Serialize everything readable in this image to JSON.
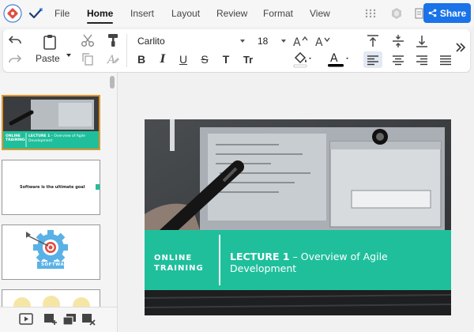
{
  "menu": {
    "items": [
      "File",
      "Home",
      "Insert",
      "Layout",
      "Review",
      "Format",
      "View"
    ],
    "active": "Home",
    "share_label": "Share"
  },
  "toolbar": {
    "paste_label": "Paste",
    "font_name": "Carlito",
    "font_size": "18",
    "font_color": "#000000",
    "highlight_color": "#ffffff"
  },
  "slides": [
    {
      "left_text": "ONLINE TRAINING",
      "title_bold": "LECTURE 1",
      "title_rest": " – Overview of Agile Development"
    },
    {
      "text": "Software is the ultimate goal"
    },
    {
      "label": "SOFTWA"
    },
    {}
  ],
  "current_slide": {
    "left_text_line1": "ONLINE",
    "left_text_line2": "TRAINING",
    "title_bold": "LECTURE 1",
    "title_rest": " – Overview of Agile Development"
  },
  "colors": {
    "accent": "#1fbf9c",
    "share": "#1a73e8",
    "selection": "#e0962e"
  }
}
